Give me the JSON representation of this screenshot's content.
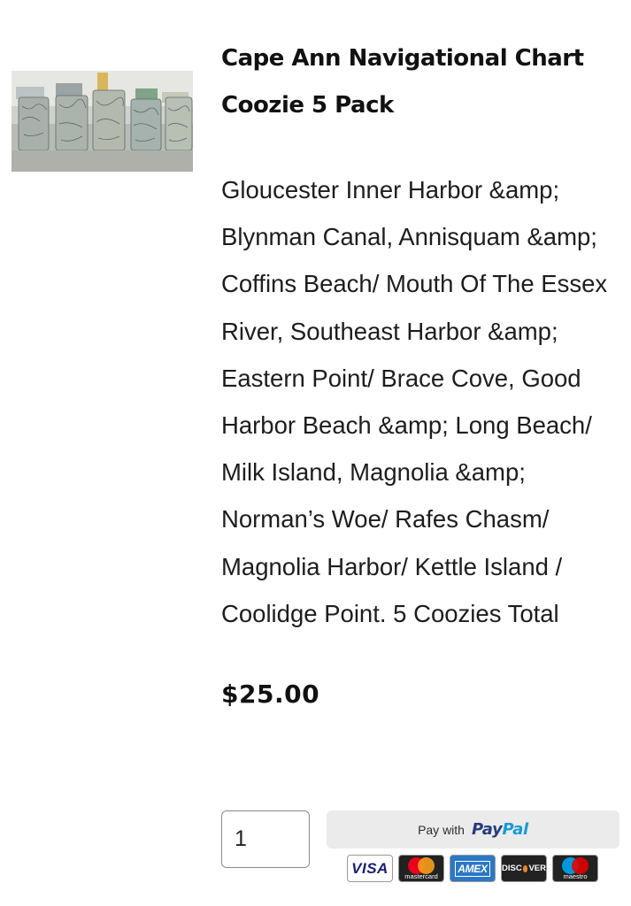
{
  "product": {
    "image_alt": "Five chart-printed can coozies on bottles",
    "title": "Cape Ann Navigational Chart Coozie 5 Pack",
    "description": "Gloucester Inner Harbor &amp; Blynman Canal, Annisquam &amp; Coffins Beach/ Mouth Of The Essex River, Southeast Harbor &amp; Eastern Point/ Brace Cove, Good Harbor Beach &amp; Long Beach/ Milk Island, Magnolia &amp; Norman’s Woe/ Rafes Chasm/ Magnolia Harbor/ Kettle Island / Coolidge Point. 5 Coozies Total",
    "price": "$25.00"
  },
  "purchase": {
    "quantity": "1",
    "paypal_prefix": "Pay with",
    "paypal_pay": "Pay",
    "paypal_pal": "Pal"
  },
  "payment_cards": {
    "visa": "VISA",
    "mastercard": "mastercard",
    "amex": "AMEX",
    "discover_a": "DISC",
    "discover_b": "VER",
    "maestro": "maestro"
  },
  "colors": {
    "paypal_dark": "#253b80",
    "paypal_light": "#179bd7",
    "button_bg": "#ebebeb"
  }
}
